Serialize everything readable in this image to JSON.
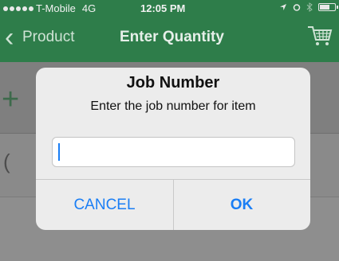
{
  "status_bar": {
    "carrier": "T-Mobile",
    "network": "4G",
    "time": "12:05 PM"
  },
  "nav": {
    "back_label": "Product",
    "title": "Enter Quantity",
    "cart_icon": "shopping-cart-icon"
  },
  "background_rows": {
    "row1_icon": "plus-icon",
    "row2_glyph": "("
  },
  "alert": {
    "title": "Job Number",
    "message": "Enter the job number for item",
    "input_value": "",
    "cancel_label": "CANCEL",
    "ok_label": "OK"
  },
  "colors": {
    "header_green": "#2e7d4a",
    "button_blue": "#1a7ef5",
    "dialog_bg": "#ececec"
  }
}
